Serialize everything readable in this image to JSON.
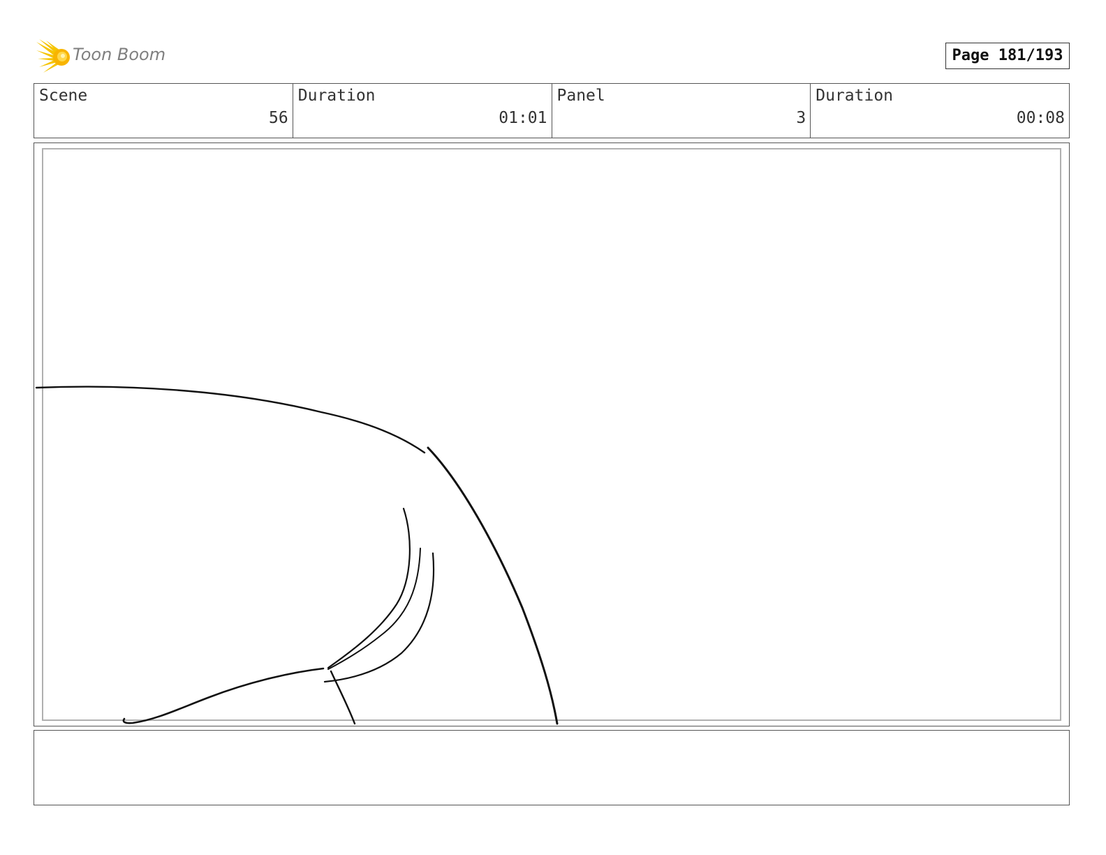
{
  "header": {
    "logo_text": "Toon Boom",
    "page_label": "Page 181/193"
  },
  "info": {
    "scene_label": "Scene",
    "scene_value": "56",
    "scene_duration_label": "Duration",
    "scene_duration_value": "01:01",
    "panel_label": "Panel",
    "panel_value": "3",
    "panel_duration_label": "Duration",
    "panel_duration_value": "00:08"
  },
  "icons": {
    "logo": "toon-boom-starburst-icon"
  },
  "colors": {
    "logo_yellow": "#f5c400",
    "logo_text": "#7f7f7f",
    "frame_border": "#555555",
    "inner_border": "#b0b0b0"
  }
}
